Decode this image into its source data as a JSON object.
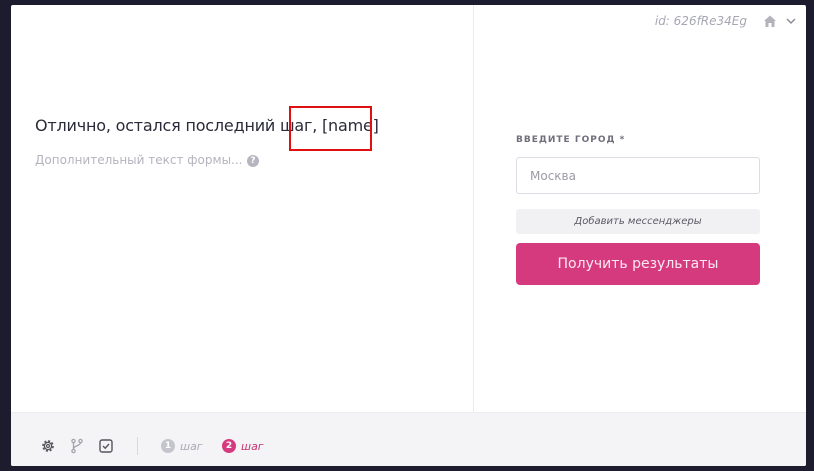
{
  "header": {
    "id_text": "id: 626fRe34Eg",
    "home_icon": "home-icon",
    "menu_icon": "chevron-down-icon"
  },
  "left": {
    "heading": "Отлично, остался последний шаг, [name]",
    "subtext": "Дополнительный текст формы...",
    "help_glyph": "?"
  },
  "form": {
    "city_label": "ВВЕДИТЕ ГОРОД *",
    "city_placeholder": "Москва",
    "messengers_label": "Добавить мессенджеры",
    "submit_label": "Получить результаты"
  },
  "footer": {
    "icons": [
      "gear-icon",
      "branch-icon",
      "checklist-icon"
    ],
    "steps": [
      {
        "num": "1",
        "label": "шаг",
        "color": "#c4c4cc",
        "label_color": "#a9a9b4",
        "active": false
      },
      {
        "num": "2",
        "label": "шаг",
        "color": "#d63a7e",
        "label_color": "#c43373",
        "active": true
      }
    ]
  },
  "colors": {
    "accent": "#d63a7e",
    "highlight": "#e01010"
  }
}
